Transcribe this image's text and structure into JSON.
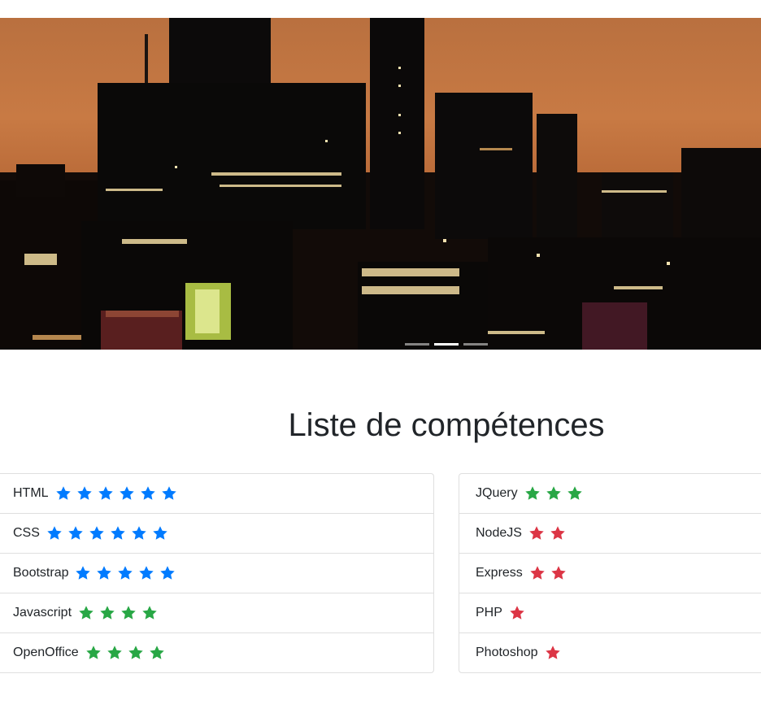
{
  "carousel": {
    "slide_count": 3,
    "active_index": 1,
    "image": "city-skyline-at-dusk"
  },
  "skills": {
    "title": "Liste de compétences",
    "colors": {
      "blue": "#007bff",
      "green": "#28a745",
      "red": "#dc3545"
    },
    "left": [
      {
        "name": "HTML",
        "stars": 6,
        "color": "blue"
      },
      {
        "name": "CSS",
        "stars": 6,
        "color": "blue"
      },
      {
        "name": "Bootstrap",
        "stars": 5,
        "color": "blue"
      },
      {
        "name": "Javascript",
        "stars": 4,
        "color": "green"
      },
      {
        "name": "OpenOffice",
        "stars": 4,
        "color": "green"
      }
    ],
    "right": [
      {
        "name": "JQuery",
        "stars": 3,
        "color": "green"
      },
      {
        "name": "NodeJS",
        "stars": 2,
        "color": "red"
      },
      {
        "name": "Express",
        "stars": 2,
        "color": "red"
      },
      {
        "name": "PHP",
        "stars": 1,
        "color": "red"
      },
      {
        "name": "Photoshop",
        "stars": 1,
        "color": "red"
      }
    ],
    "star_icon": "star-icon"
  }
}
